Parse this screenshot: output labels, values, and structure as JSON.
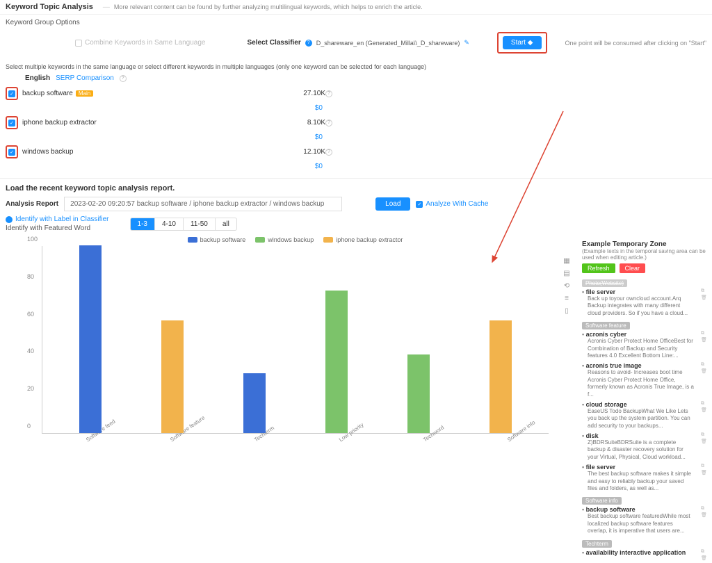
{
  "header": {
    "title": "Keyword Topic Analysis",
    "subtitle": "More relevant content can be found by further analyzing multilingual keywords, which helps to enrich the article."
  },
  "options": {
    "section_label": "Keyword Group Options",
    "combine_label": "Combine Keywords in Same Language",
    "classifier_label": "Select Classifier",
    "classifier_value": "D_shareware_en (Generated_Milla\\\\_D_shareware)",
    "start_label": "Start",
    "start_hint": "One point will be consumed after clicking on \"Start\""
  },
  "instruction": "Select multiple keywords in the same language or select different keywords in multiple languages (only one keyword can be selected for each language)",
  "lang": {
    "name": "English",
    "serp_link": "SERP Comparison"
  },
  "keywords": [
    {
      "name": "backup software",
      "main": true,
      "vol": "27.10K",
      "cost": "$0"
    },
    {
      "name": "iphone backup extractor",
      "main": false,
      "vol": "8.10K",
      "cost": "$0"
    },
    {
      "name": "windows backup",
      "main": false,
      "vol": "12.10K",
      "cost": "$0"
    }
  ],
  "report": {
    "heading": "Load the recent keyword topic analysis report.",
    "label": "Analysis Report",
    "select_value": "2023-02-20 09:20:57 backup software / iphone backup extractor / windows backup",
    "load_label": "Load",
    "cache_label": "Analyze With Cache"
  },
  "identify": {
    "with_label": "Identify with Label in Classifier",
    "featured": "Identify with Featured Word",
    "segments": [
      "1-3",
      "4-10",
      "11-50",
      "all"
    ],
    "active_segment": 0
  },
  "chart_data": {
    "type": "bar",
    "title": "",
    "xlabel": "",
    "ylabel": "",
    "ylim": [
      0,
      100
    ],
    "y_ticks": [
      0,
      20,
      40,
      60,
      80,
      100
    ],
    "series": [
      {
        "name": "backup software",
        "color": "#3b6fd6"
      },
      {
        "name": "windows backup",
        "color": "#7cc36a"
      },
      {
        "name": "iphone backup extractor",
        "color": "#f2b34c"
      }
    ],
    "categories": [
      "Software feed",
      "Software feature",
      "Techterm",
      "Low priority",
      "Techword",
      "Software info"
    ],
    "data": [
      {
        "category": "Software feed",
        "series": "backup software",
        "value": 100
      },
      {
        "category": "Software feature",
        "series": "iphone backup extractor",
        "value": 60
      },
      {
        "category": "Techterm",
        "series": "backup software",
        "value": 32
      },
      {
        "category": "Low priority",
        "series": "windows backup",
        "value": 76
      },
      {
        "category": "Techword",
        "series": "windows backup",
        "value": 42
      },
      {
        "category": "Software info",
        "series": "iphone backup extractor",
        "value": 60
      }
    ]
  },
  "temp_zone": {
    "title": "Example Temporary Zone",
    "subtitle": "(Example texts in the temporal saving area can be used when editing article.)",
    "refresh": "Refresh",
    "clear": "Clear",
    "groups": [
      {
        "tag": "Photo(Website)",
        "strike": true,
        "items": [
          {
            "title": "file server",
            "desc": "Back up toyour owncloud account.Arq Backup integrates with many different cloud providers. So if you have a cloud..."
          }
        ]
      },
      {
        "tag": "Software feature",
        "strike": false,
        "items": [
          {
            "title": "acronis cyber",
            "desc": "Acronis Cyber Protect Home OfficeBest for Combination of Backup and Security features 4.0 Excellent Bottom Line:..."
          },
          {
            "title": "acronis true image",
            "desc": "Reasons to avoid- Increases boot time Acronis Cyber Protect Home Office, formerly known as Acronis True Image, is a f..."
          },
          {
            "title": "cloud storage",
            "desc": "EaseUS Todo BackupWhat We Like Lets you back up the system partition. You can add security to your backups..."
          },
          {
            "title": "disk",
            "desc": "Z)BDRSuiteBDRSuite is a complete backup & disaster recovery solution for your Virtual, Physical, Cloud workload..."
          },
          {
            "title": "file server",
            "desc": "The best backup software makes it simple and easy to reliably backup your saved files and folders, as well as..."
          }
        ]
      },
      {
        "tag": "Software info",
        "strike": false,
        "items": [
          {
            "title": "backup software",
            "desc": "Best backup software featuredWhile most localized backup software features overlap, it is imperative that users are..."
          }
        ]
      },
      {
        "tag": "Techterm",
        "strike": false,
        "items": [
          {
            "title": "availability interactive application",
            "desc": ""
          }
        ]
      }
    ]
  }
}
